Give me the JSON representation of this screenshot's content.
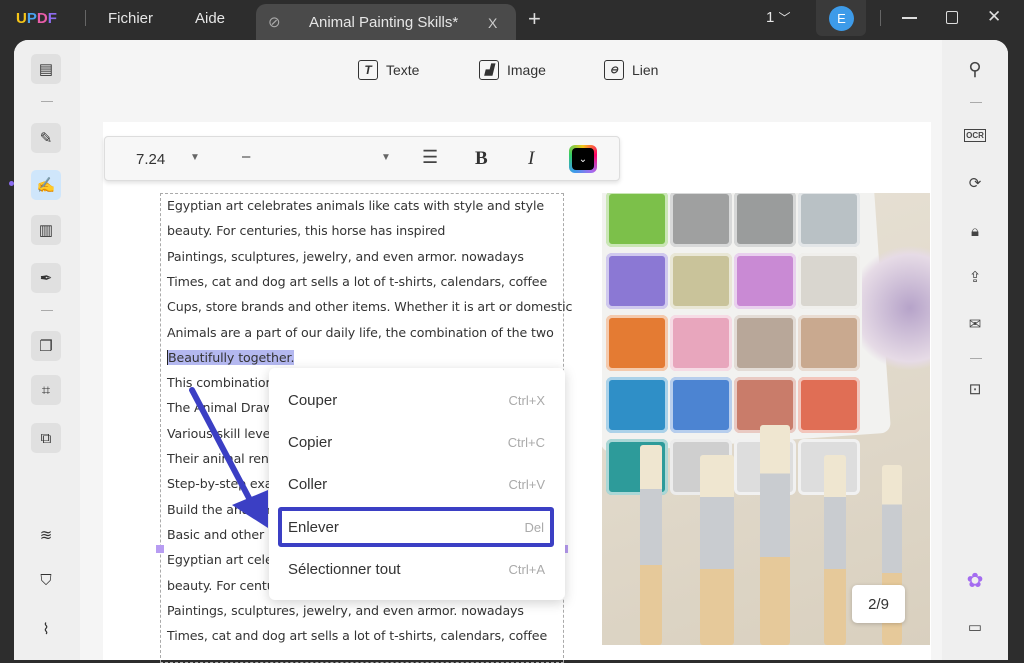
{
  "titlebar": {
    "logo": "UPDF",
    "menu": [
      "Fichier",
      "Aide"
    ],
    "tab_title": "Animal Painting Skills*",
    "tab_close": "X",
    "new_tab": "+",
    "page_count": "1",
    "avatar_letter": "E"
  },
  "toolbar": {
    "items": [
      {
        "label": "Texte",
        "icon": "text-box-icon"
      },
      {
        "label": "Image",
        "icon": "image-icon"
      },
      {
        "label": "Lien",
        "icon": "link-icon"
      }
    ]
  },
  "format_bar": {
    "font_size": "7.24",
    "font_name": "–",
    "bold": "B",
    "italic": "I",
    "color": "#000000"
  },
  "document": {
    "lines": [
      "Egyptian art celebrates animals like cats with style and style",
      "beauty. For centuries, this horse has inspired",
      "Paintings, sculptures, jewelry, and even armor. nowadays",
      "Times, cat and dog art sells a lot of t-shirts, calendars, coffee",
      "Cups, store brands and other items. Whether it is art or domestic",
      "Animals are a part of our daily life, the combination of the two",
      "Beautifully together.",
      "This combination",
      "The Animal Drawi",
      "Various skill leve",
      "Their animal ren",
      "Step-by-step exa",
      "Build the anatom",
      "Basic and other r",
      "Egyptian art cele",
      "beauty. For centu",
      "Paintings, sculptures, jewelry, and even armor. nowadays",
      "Times, cat and dog art sells a lot of t-shirts, calendars, coffee"
    ],
    "selected_line": "Beautifully together."
  },
  "context_menu": {
    "items": [
      {
        "label": "Couper",
        "shortcut": "Ctrl+X"
      },
      {
        "label": "Copier",
        "shortcut": "Ctrl+C"
      },
      {
        "label": "Coller",
        "shortcut": "Ctrl+V"
      },
      {
        "label": "Enlever",
        "shortcut": "Del",
        "highlighted": true
      },
      {
        "label": "Sélectionner tout",
        "shortcut": "Ctrl+A"
      }
    ]
  },
  "page_indicator": "2/9",
  "colors": {
    "accent": "#3b3fc4",
    "selection": "#b4b8f0",
    "titlebar": "#2d2d2d",
    "avatar": "#3d9be9"
  }
}
